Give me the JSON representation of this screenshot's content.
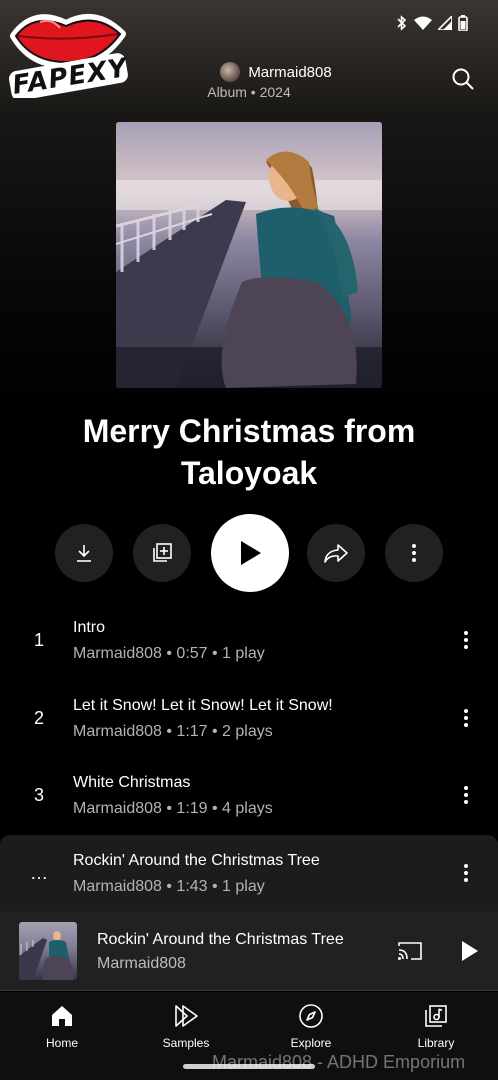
{
  "logo": {
    "text": "FAPEXY"
  },
  "header": {
    "artist": "Marmaid808",
    "meta": "Album • 2024"
  },
  "album": {
    "title": "Merry Christmas from Taloyoak"
  },
  "actions": {
    "icons": [
      "download-icon",
      "add-to-queue-icon",
      "play-icon",
      "share-icon",
      "more-icon"
    ]
  },
  "tracks": [
    {
      "num": "1",
      "title": "Intro",
      "sub": "Marmaid808 • 0:57 • 1 play"
    },
    {
      "num": "2",
      "title": "Let it Snow! Let it Snow! Let it Snow!",
      "sub": "Marmaid808 • 1:17 • 2 plays"
    },
    {
      "num": "3",
      "title": "White Christmas",
      "sub": "Marmaid808 • 1:19 • 4 plays"
    },
    {
      "num": "…",
      "title": "Rockin' Around the Christmas Tree",
      "sub": "Marmaid808 • 1:43 • 1 play"
    }
  ],
  "mini_player": {
    "title": "Rockin' Around the Christmas Tree",
    "artist": "Marmaid808"
  },
  "nav": [
    {
      "label": "Home",
      "icon": "home-icon"
    },
    {
      "label": "Samples",
      "icon": "samples-icon"
    },
    {
      "label": "Explore",
      "icon": "explore-icon"
    },
    {
      "label": "Library",
      "icon": "library-icon"
    }
  ],
  "watermark": "Marmaid808 - ADHD Emporium",
  "colors": {
    "background": "#000000",
    "surface": "#212121",
    "text_secondary": "#b3b3b3"
  }
}
